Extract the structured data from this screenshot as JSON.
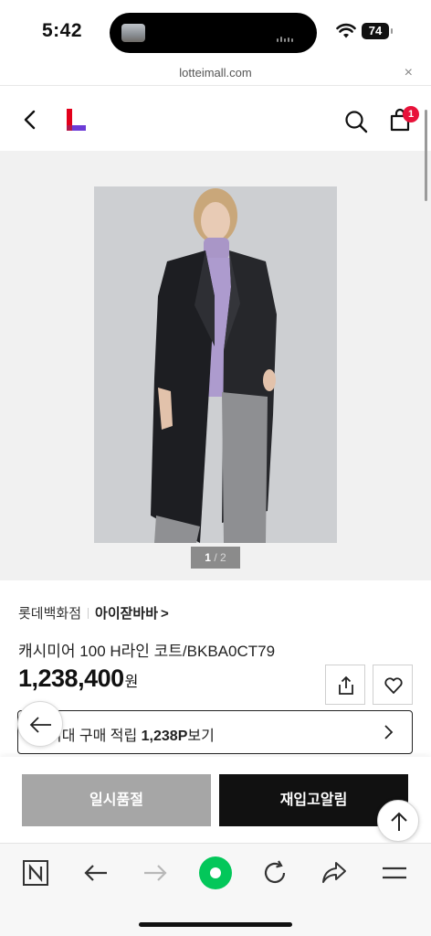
{
  "status_bar": {
    "time": "5:42",
    "battery": "74"
  },
  "browser": {
    "url": "lotteimall.com",
    "close_label": "×"
  },
  "header": {
    "cart_count": "1"
  },
  "gallery": {
    "current": "1",
    "separator": "/",
    "total": "2"
  },
  "product": {
    "store": "롯데백화점",
    "brand": "아이잗바바",
    "brand_arrow": ">",
    "name": "캐시미어 100 H라인 코트/BKBA0CT79",
    "price": "1,238,400",
    "price_unit": "원",
    "points_prefix": "최대 구매 적립 ",
    "points_value": "1,238P",
    "points_suffix": "보기"
  },
  "actions": {
    "soldout_label": "일시품절",
    "restock_label": "재입고알림"
  },
  "colors": {
    "badge": "#e8123a",
    "logo_red": "#e3001b",
    "logo_purple": "#6c3bd6",
    "naver_green": "#03c75a"
  }
}
